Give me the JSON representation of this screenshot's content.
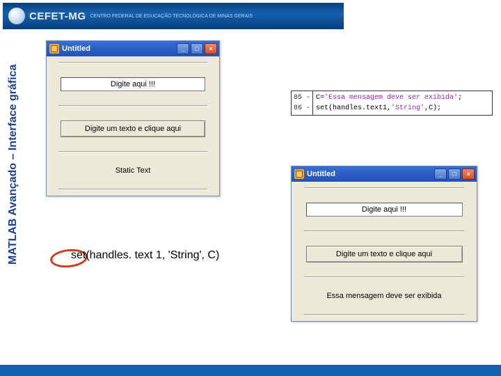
{
  "header": {
    "org": "CEFET-MG",
    "org_full": "CENTRO FEDERAL DE EDUCAÇÃO TECNOLÓGICA DE MINAS GERAIS"
  },
  "sidebar": {
    "caption": "MATLAB Avançado – Interface gráfica"
  },
  "window1": {
    "title": "Untitled",
    "edit_placeholder": "Digite aqui !!!",
    "button_label": "Digite um texto e clique aqui",
    "static_label": "Static Text",
    "btn_min": "_",
    "btn_max": "□",
    "btn_close": "×"
  },
  "window2": {
    "title": "Untitled",
    "edit_placeholder": "Digite aqui !!!",
    "button_label": "Digite um texto e clique aqui",
    "static_label": "Essa mensagem deve ser exibida",
    "btn_min": "_",
    "btn_max": "□",
    "btn_close": "×"
  },
  "code": {
    "line_nums": "85 -\n86 -",
    "line1_a": "C=",
    "line1_str": "'Essa mensagem deve ser exibida'",
    "line1_b": ";",
    "line2_a": "set(handles.text1,",
    "line2_str": "'String'",
    "line2_b": ",C);"
  },
  "callout": {
    "text": "set(handles. text 1, 'String', C)"
  }
}
